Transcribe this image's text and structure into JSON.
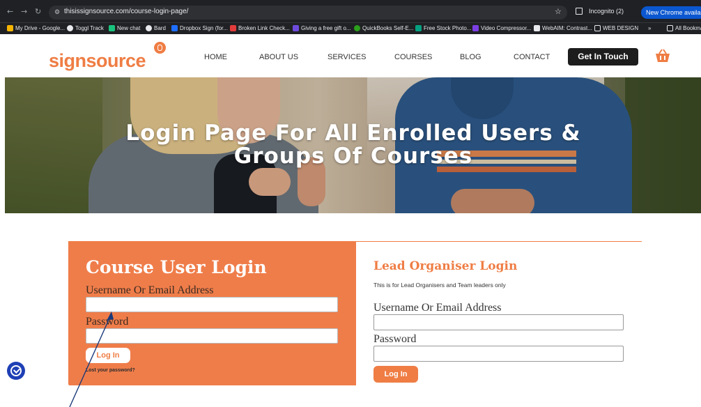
{
  "browser": {
    "url": "thisissignsource.com/course-login-page/",
    "incognito_label": "Incognito (2)",
    "update_label": "New Chrome available",
    "bookmarks": [
      {
        "label": "My Drive - Google...",
        "color": "#f4b400"
      },
      {
        "label": "Toggl Track",
        "color": "#e8eaed"
      },
      {
        "label": "New chat",
        "color": "#19c37d"
      },
      {
        "label": "Bard",
        "color": "#e8eaed"
      },
      {
        "label": "Dropbox Sign (for...",
        "color": "#1e6fff"
      },
      {
        "label": "Broken Link Check...",
        "color": "#e23b3b"
      },
      {
        "label": "Giving a free gift o...",
        "color": "#6e4adc"
      },
      {
        "label": "QuickBooks Self-E...",
        "color": "#2ca01c"
      },
      {
        "label": "Free Stock Photo...",
        "color": "#05a081"
      },
      {
        "label": "Video Compressor...",
        "color": "#7b3fe4"
      },
      {
        "label": "WebAIM: Contrast...",
        "color": "#e8eaed"
      },
      {
        "label": "WEB DESIGN",
        "color": "#202124"
      },
      {
        "label": "All Bookmarks",
        "color": "#202124"
      }
    ]
  },
  "site": {
    "logo": "signsource",
    "nav": [
      "HOME",
      "ABOUT US",
      "SERVICES",
      "COURSES",
      "BLOG",
      "CONTACT"
    ],
    "cta": "Get In Touch",
    "brand_color": "#ef7d44"
  },
  "hero": {
    "title_line1": "Login Page For All Enrolled Users &",
    "title_line2": "Groups Of Courses"
  },
  "course_login": {
    "title": "Course User Login",
    "username_label": "Username Or Email Address",
    "password_label": "Password",
    "button": "Log In",
    "lost_password": "Lost your password?"
  },
  "lead_login": {
    "title": "Lead Organiser Login",
    "note": "This is for Lead Organisers and Team leaders only",
    "username_label": "Username Or Email Address",
    "password_label": "Password",
    "button": "Log In"
  }
}
